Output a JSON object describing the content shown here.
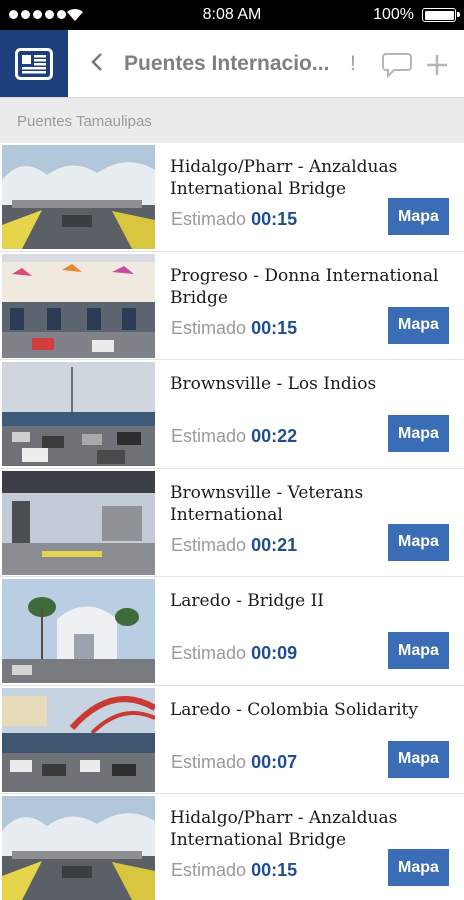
{
  "status_bar": {
    "time": "8:08 AM",
    "battery": "100%"
  },
  "nav": {
    "title": "Puentes Internacio...",
    "title_suffix": "!",
    "icons": [
      "newspaper-icon",
      "back-chevron-icon",
      "chat-bubble-icon",
      "plus-icon"
    ]
  },
  "section_header": "Puentes Tamaulipas",
  "bridges": [
    {
      "name": "Hidalgo/Pharr - Anzalduas International Bridge",
      "estimate_label": "Estimado",
      "time": "00:15",
      "button": "Mapa"
    },
    {
      "name": "Progreso - Donna International Bridge",
      "estimate_label": "Estimado",
      "time": "00:15",
      "button": "Mapa"
    },
    {
      "name": "Brownsville - Los Indios",
      "estimate_label": "Estimado",
      "time": "00:22",
      "button": "Mapa"
    },
    {
      "name": "Brownsville - Veterans International",
      "estimate_label": "Estimado",
      "time": "00:21",
      "button": "Mapa"
    },
    {
      "name": "Laredo - Bridge II",
      "estimate_label": "Estimado",
      "time": "00:09",
      "button": "Mapa"
    },
    {
      "name": "Laredo - Colombia Solidarity",
      "estimate_label": "Estimado",
      "time": "00:07",
      "button": "Mapa"
    },
    {
      "name": "Hidalgo/Pharr - Anzalduas International Bridge",
      "estimate_label": "Estimado",
      "time": "00:15",
      "button": "Mapa"
    }
  ],
  "colors": {
    "brand_blue": "#1d3f7b",
    "button_blue": "#3a6db5",
    "time_blue": "#1f4e8c"
  }
}
